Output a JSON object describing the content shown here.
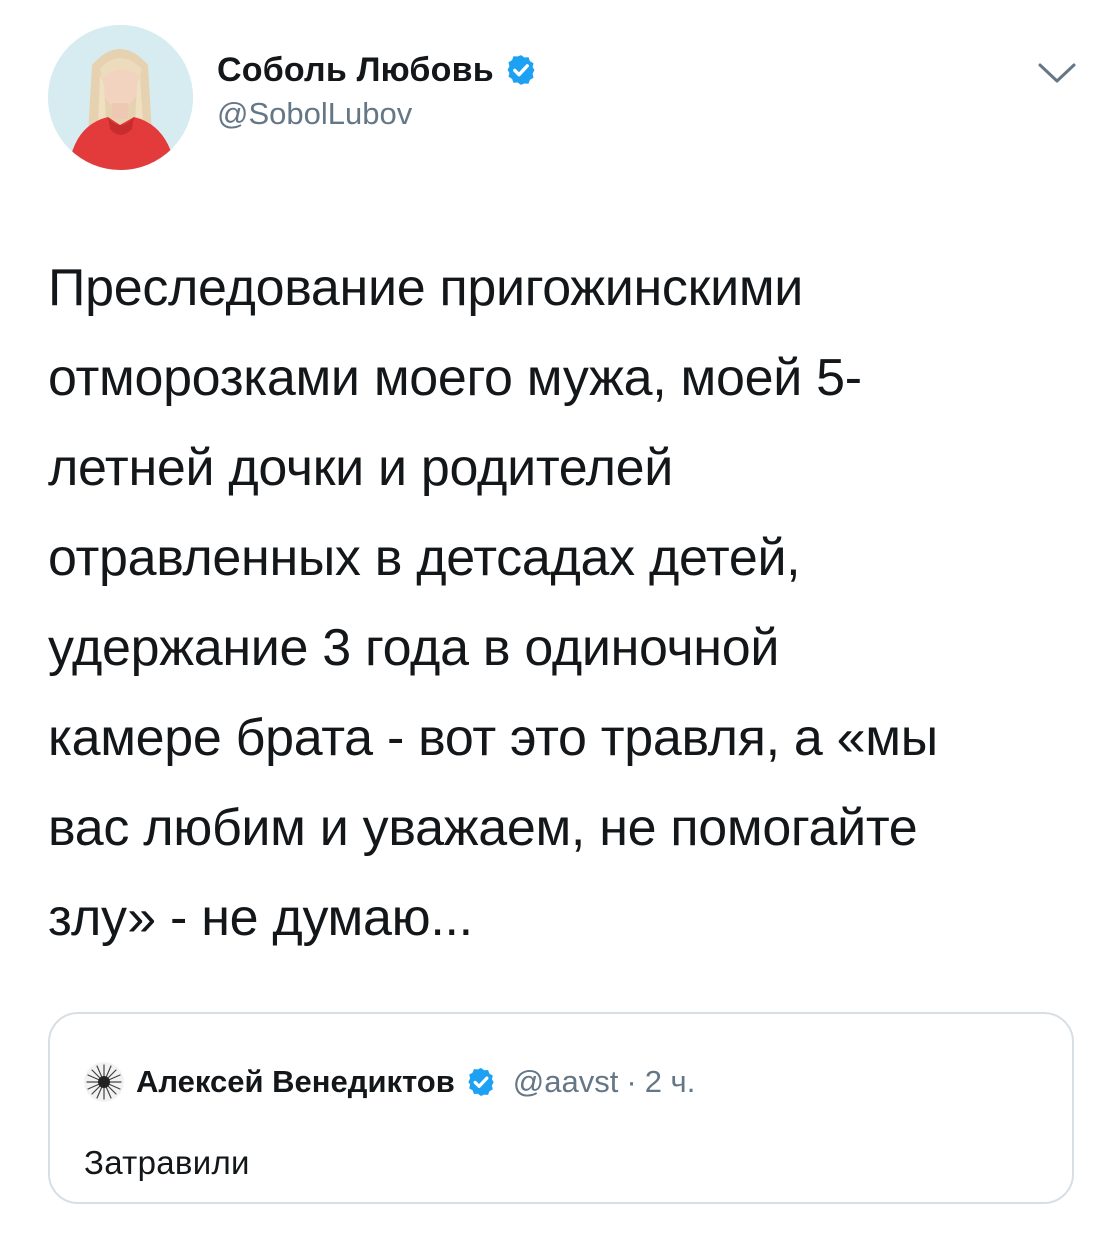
{
  "tweet": {
    "author": {
      "display_name": "Соболь Любовь",
      "handle": "@SobolLubov",
      "verified": true
    },
    "text": "Преследование пригожинскими\nотморозками моего мужа, моей 5-\nлетней дочки и родителей\nотравленных в детсадах детей,\nудержание 3 года в одиночной\nкамере брата - вот это травля, а «мы\nвас любим и уважаем, не помогайте\nзлу» - не думаю...",
    "menu_icon": "chevron-down-icon"
  },
  "quoted_tweet": {
    "display_name": "Алексей Венедиктов",
    "handle": "@aavst",
    "separator": "·",
    "time": "2 ч.",
    "verified": true,
    "text": "Затравили"
  },
  "colors": {
    "text_primary": "#14171a",
    "text_secondary": "#657786",
    "verified_blue": "#1da1f2",
    "border": "#d8dfe4"
  }
}
